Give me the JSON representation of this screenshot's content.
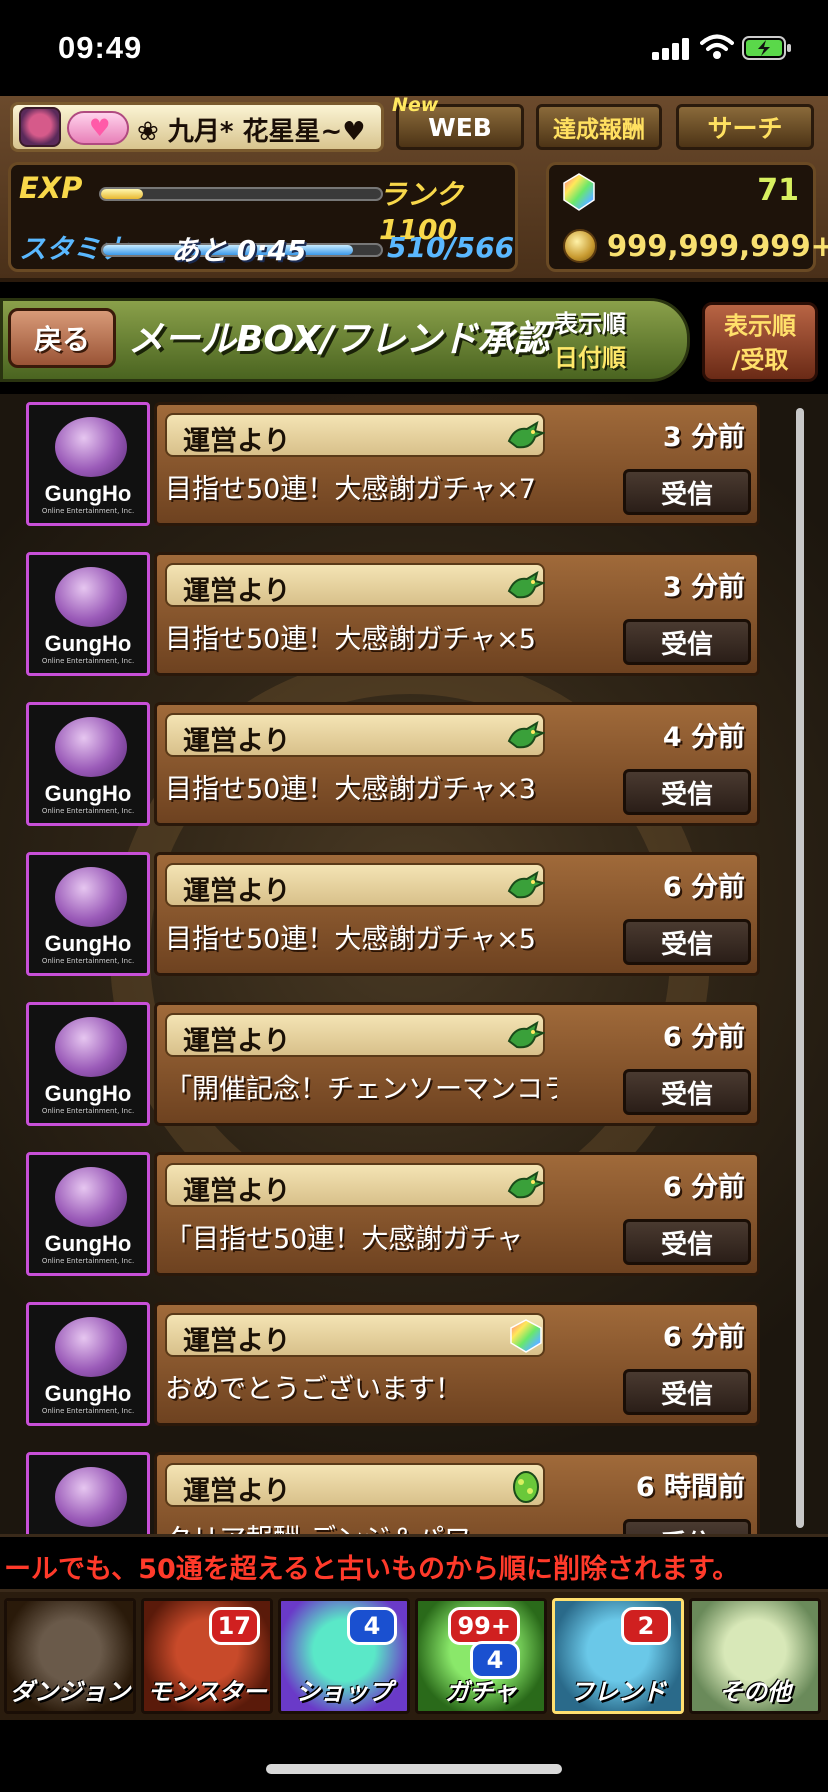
{
  "status_bar": {
    "time": "09:49"
  },
  "header": {
    "player_name": "❀ 九月*  花星星~♥",
    "new_tag": "New",
    "web_button": "WEB",
    "achievement_button": "達成報酬",
    "search_button": "サーチ",
    "exp_label": "EXP",
    "exp_progress": 0.15,
    "rank": "ランク1100",
    "stamina_label": "スタミナ",
    "stamina_timer": "あと 0:45",
    "stamina_progress": 0.9,
    "stamina_value": "510/566",
    "magic_stones": "71",
    "coins": "999,999,999+"
  },
  "titlebar": {
    "back_button": "戻る",
    "title": "メールBOX/フレンド承認",
    "sort_label": "表示順",
    "sort_value": "日付順",
    "sort_button_line1": "表示順",
    "sort_button_line2": "/受取"
  },
  "logo": {
    "text": "GungHo",
    "sub": "Online Entertainment, Inc."
  },
  "receive_label": "受信",
  "mails": [
    {
      "sender": "運営より",
      "subject": "目指せ50連！大感謝ガチャ×7",
      "time": "3 分前",
      "icon": "dragon-icon"
    },
    {
      "sender": "運営より",
      "subject": "目指せ50連！大感謝ガチャ×5",
      "time": "3 分前",
      "icon": "dragon-icon"
    },
    {
      "sender": "運営より",
      "subject": "目指せ50連！大感謝ガチャ×3",
      "time": "4 分前",
      "icon": "dragon-icon"
    },
    {
      "sender": "運営より",
      "subject": "目指せ50連！大感謝ガチャ×5",
      "time": "6 分前",
      "icon": "dragon-icon"
    },
    {
      "sender": "運営より",
      "subject": "「開催記念！チェンソーマンコラ",
      "time": "6 分前",
      "icon": "dragon-icon"
    },
    {
      "sender": "運営より",
      "subject": "「目指せ50連！大感謝ガチャ",
      "time": "6 分前",
      "icon": "dragon-icon"
    },
    {
      "sender": "運営より",
      "subject": "おめでとうございます！",
      "time": "6 分前",
      "icon": "magic-stone-icon"
    },
    {
      "sender": "運営より",
      "subject": "クリア報酬:デンジ＆パワ",
      "time": "6 時間前",
      "icon": "egg-icon"
    }
  ],
  "ticker": "ールでも、50通を超えると古いものから順に削除されます。",
  "nav": [
    {
      "label": "ダンジョン",
      "badges": []
    },
    {
      "label": "モンスター",
      "badges": [
        "17"
      ]
    },
    {
      "label": "ショップ",
      "badges": [
        "4"
      ]
    },
    {
      "label": "ガチャ",
      "badges": [
        "99+",
        "4"
      ]
    },
    {
      "label": "フレンド",
      "badges": [
        "2"
      ]
    },
    {
      "label": "その他",
      "badges": []
    }
  ]
}
